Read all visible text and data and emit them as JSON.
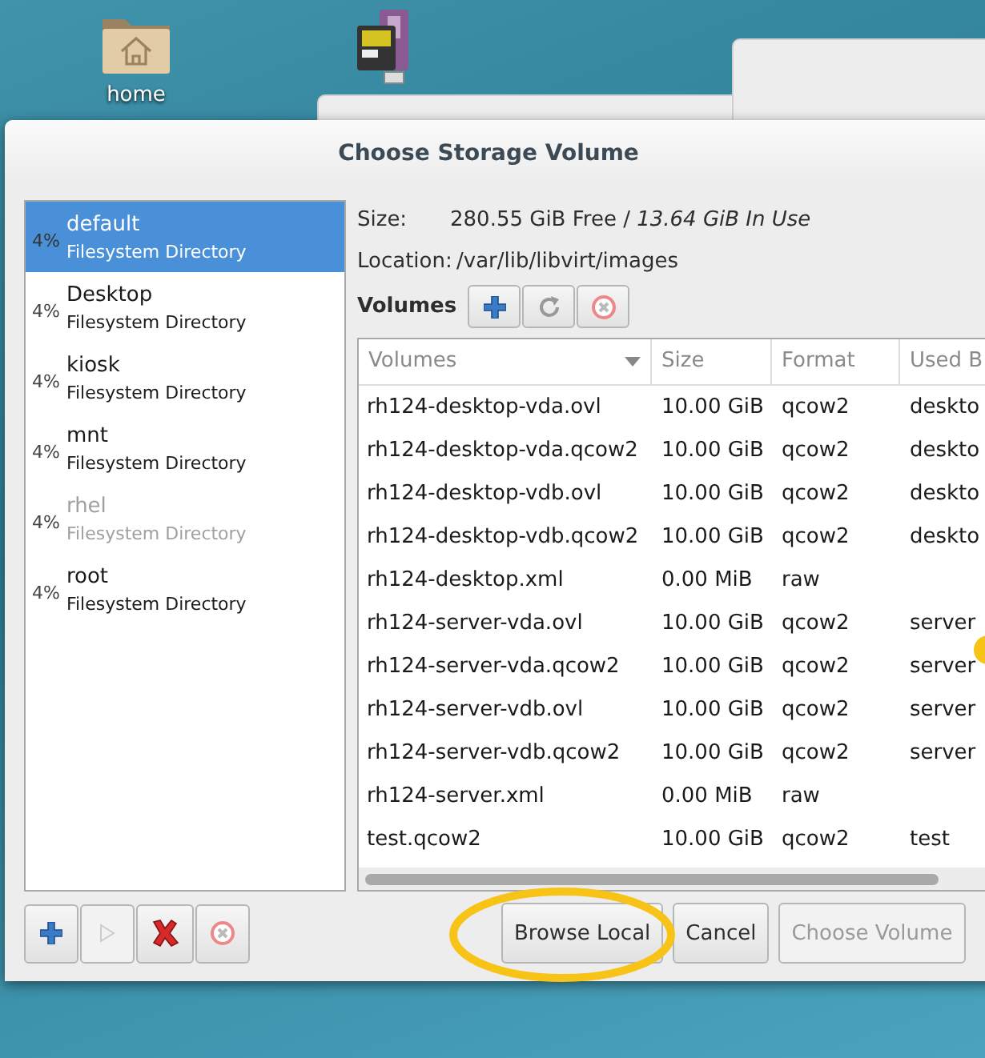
{
  "desktop": {
    "icons": [
      {
        "kind": "folder",
        "label": "home"
      },
      {
        "kind": "drive"
      }
    ]
  },
  "dialog": {
    "title": "Choose Storage Volume",
    "pools": [
      {
        "percent": "4%",
        "name": "default",
        "type": "Filesystem Directory",
        "selected": true,
        "disabled": false
      },
      {
        "percent": "4%",
        "name": "Desktop",
        "type": "Filesystem Directory",
        "selected": false,
        "disabled": false
      },
      {
        "percent": "4%",
        "name": "kiosk",
        "type": "Filesystem Directory",
        "selected": false,
        "disabled": false
      },
      {
        "percent": "4%",
        "name": "mnt",
        "type": "Filesystem Directory",
        "selected": false,
        "disabled": false
      },
      {
        "percent": "4%",
        "name": "rhel",
        "type": "Filesystem Directory",
        "selected": false,
        "disabled": true
      },
      {
        "percent": "4%",
        "name": "root",
        "type": "Filesystem Directory",
        "selected": false,
        "disabled": false
      }
    ],
    "pool_buttons": [
      {
        "kind": "add",
        "disabled": false
      },
      {
        "kind": "start",
        "disabled": true
      },
      {
        "kind": "delete",
        "disabled": false
      },
      {
        "kind": "stop",
        "disabled": false
      }
    ],
    "details": [
      {
        "label": "Size:",
        "value": "280.55 GiB Free / *13.64 GiB In Use*"
      },
      {
        "label": "Location:",
        "value": "/var/lib/libvirt/images"
      }
    ],
    "volumes_label": "Volumes",
    "volume_buttons": [
      {
        "kind": "add"
      },
      {
        "kind": "refresh"
      },
      {
        "kind": "delete"
      }
    ],
    "table": {
      "columns": [
        {
          "label": "Volumes",
          "sorted": true
        },
        {
          "label": "Size",
          "sorted": false
        },
        {
          "label": "Format",
          "sorted": false
        },
        {
          "label": "Used B",
          "sorted": false
        }
      ],
      "rows": [
        [
          "rh124-desktop-vda.ovl",
          "10.00 GiB",
          "qcow2",
          "deskto"
        ],
        [
          "rh124-desktop-vda.qcow2",
          "10.00 GiB",
          "qcow2",
          "deskto"
        ],
        [
          "rh124-desktop-vdb.ovl",
          "10.00 GiB",
          "qcow2",
          "deskto"
        ],
        [
          "rh124-desktop-vdb.qcow2",
          "10.00 GiB",
          "qcow2",
          "deskto"
        ],
        [
          "rh124-desktop.xml",
          "0.00 MiB",
          "raw",
          ""
        ],
        [
          "rh124-server-vda.ovl",
          "10.00 GiB",
          "qcow2",
          "server"
        ],
        [
          "rh124-server-vda.qcow2",
          "10.00 GiB",
          "qcow2",
          "server"
        ],
        [
          "rh124-server-vdb.ovl",
          "10.00 GiB",
          "qcow2",
          "server"
        ],
        [
          "rh124-server-vdb.qcow2",
          "10.00 GiB",
          "qcow2",
          "server"
        ],
        [
          "rh124-server.xml",
          "0.00 MiB",
          "raw",
          ""
        ],
        [
          "test.qcow2",
          "10.00 GiB",
          "qcow2",
          "test"
        ]
      ]
    },
    "buttons": [
      {
        "label": "Browse Local",
        "disabled": false
      },
      {
        "label": "Cancel",
        "disabled": false
      },
      {
        "label": "Choose Volume",
        "disabled": true
      }
    ]
  }
}
